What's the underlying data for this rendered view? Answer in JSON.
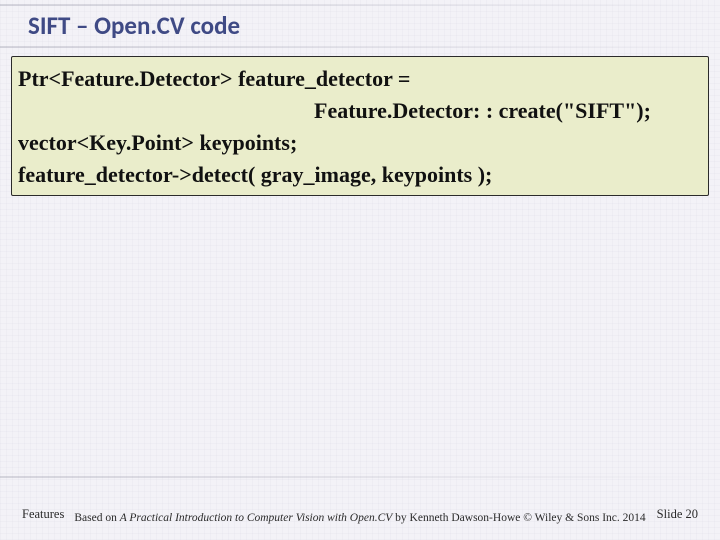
{
  "title": "SIFT – Open.CV code",
  "code": {
    "line1": "Ptr<Feature.Detector> feature_detector =",
    "line2": "Feature.Detector: : create(\"SIFT\");",
    "line3": "vector<Key.Point> keypoints;",
    "line4": "feature_detector->detect( gray_image, keypoints );"
  },
  "footer": {
    "left": "Features",
    "center_prefix": "Based on ",
    "center_book": "A Practical Introduction to Computer Vision with Open.CV",
    "center_suffix": " by Kenneth Dawson-Howe © Wiley & Sons Inc. 2014",
    "right": "Slide 20"
  }
}
